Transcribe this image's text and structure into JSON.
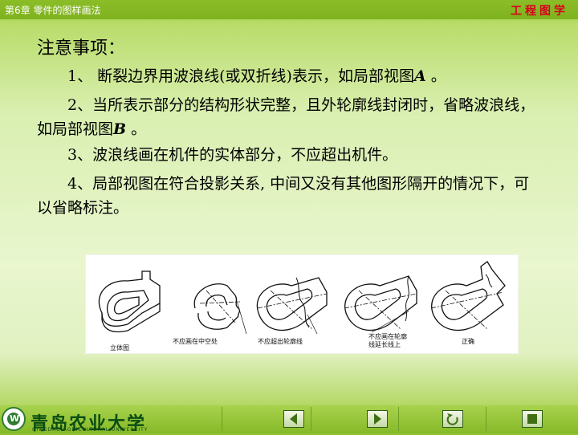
{
  "header": {
    "chapter": "第6章  零件的图样画法",
    "brand": "工程图学"
  },
  "main": {
    "heading": "注意事项：",
    "items": [
      {
        "prefix": "1、 断裂边界用波浪线(或双折线)表示，如局部视图",
        "ref": "A",
        "suffix": " 。"
      },
      {
        "prefix": "2、当所表示部分的结构形状完整，且外轮廓线封闭时，省略波浪线，如局部视图",
        "ref": "B",
        "suffix": " 。"
      },
      {
        "prefix": "3、波浪线画在机件的实体部分，不应超出机件。",
        "ref": "",
        "suffix": ""
      },
      {
        "prefix": "4、局部视图在符合投影关系, 中间又没有其他图形隔开的情况下，可以省略标注。",
        "ref": "",
        "suffix": ""
      }
    ]
  },
  "figure": {
    "labels": [
      "立体图",
      "不应画在中空处",
      "不应超出轮廓线",
      "不应画在轮廓\n线延长线上",
      "正确"
    ]
  },
  "footer": {
    "university": "青岛农业大学",
    "university_en": "QINGDAO AGRICULTURAL UNIVERSITY",
    "nav_icons": [
      "previous-icon",
      "next-icon",
      "return-icon",
      "stop-icon"
    ]
  },
  "colors": {
    "brand": "#d9001c",
    "bar": "#8bbd28",
    "logo": "#2e7d32"
  }
}
